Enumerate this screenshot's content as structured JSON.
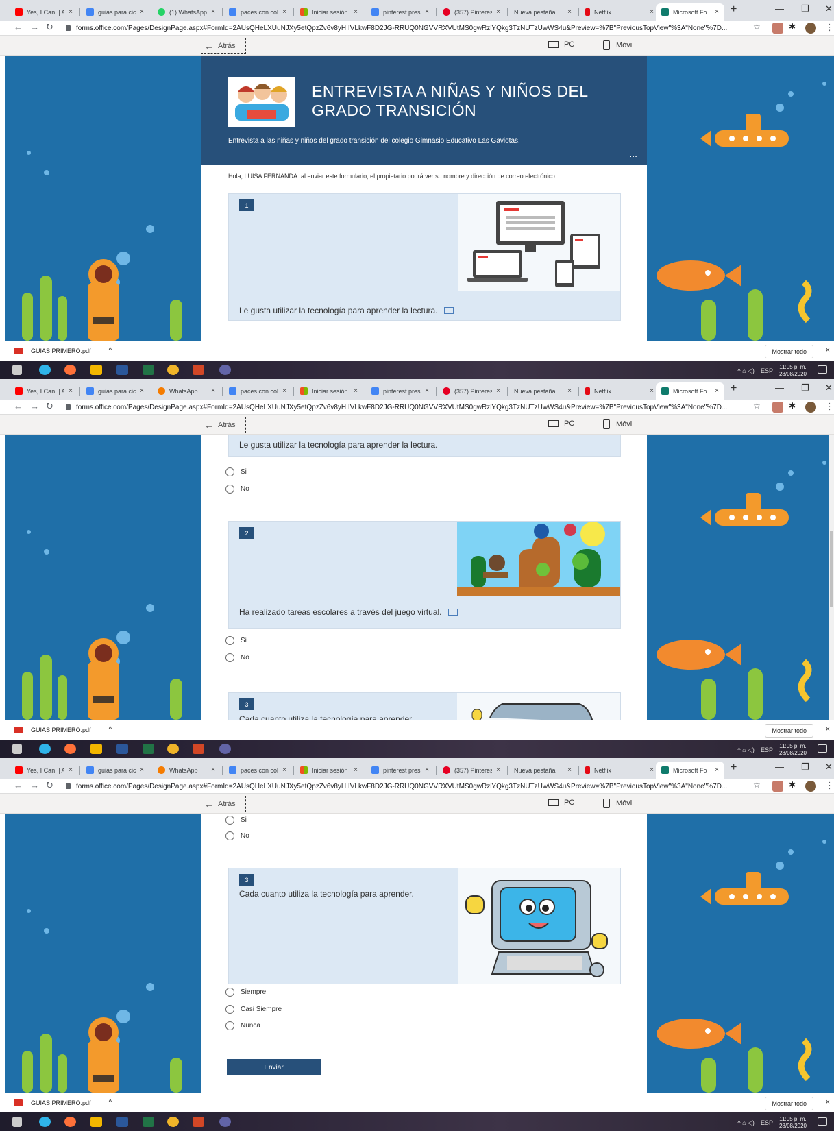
{
  "browser": {
    "tabs": [
      {
        "label": "Yes, I Can! | Al",
        "color": "#ff0000"
      },
      {
        "label": "guias para cic",
        "color": "#4285f4"
      },
      {
        "label": "(1) WhatsApp",
        "color": "#25d366"
      },
      {
        "label": "paces con col",
        "color": "#4285f4"
      },
      {
        "label": "Iniciar sesión",
        "color": "#f25022"
      },
      {
        "label": "pinterest pres",
        "color": "#4285f4"
      },
      {
        "label": "(357) Pinteres",
        "color": "#e60023"
      },
      {
        "label": "Nueva pestaña",
        "color": "#ffffff"
      },
      {
        "label": "Netflix",
        "color": "#e50914"
      },
      {
        "label": "Microsoft Fo",
        "color": "#0f7b6c"
      }
    ],
    "tabs_alt": {
      "whatsapp": "WhatsApp"
    },
    "url": "forms.office.com/Pages/DesignPage.aspx#FormId=2AUsQHeLXUuNJXy5etQpzZv6v8yHIIVLkwF8D2JG-RRUQ0NGVVRXVUtMS0gwRzlYQkg3TzNUTzUwWS4u&Preview=%7B\"PreviousTopView\"%3A\"None\"%7D...",
    "new_tab": "+",
    "close": "×"
  },
  "toolbar": {
    "back_label": "Atrás",
    "pc_label": "PC",
    "mobile_label": "Móvil"
  },
  "form": {
    "title": "ENTREVISTA A NIÑAS Y NIÑOS DEL GRADO TRANSICIÓN",
    "description": "Entrevista a las niñas y niños del grado transición del colegio Gimnasio Educativo Las Gaviotas.",
    "more": "...",
    "notice": "Hola, LUISA FERNANDA: al enviar este formulario, el propietario podrá ver su nombre y dirección de correo electrónico.",
    "questions": [
      {
        "number": "1",
        "text": "Le gusta utilizar la tecnología para aprender la lectura.",
        "options": [
          "Si",
          "No"
        ]
      },
      {
        "number": "2",
        "text": "Ha realizado tareas escolares a través del juego virtual.",
        "options": [
          "Si",
          "No"
        ]
      },
      {
        "number": "3",
        "text": "Cada cuanto utiliza la tecnología para aprender.",
        "text_partial": "Cada cuanto utiliza la tecnología para aprender",
        "options": [
          "Siempre",
          "Casi Siempre",
          "Nunca"
        ]
      }
    ],
    "submit_label": "Enviar"
  },
  "downloads": {
    "file": "GUIAS PRIMERO.pdf",
    "caret": "^",
    "show_all": "Mostrar todo",
    "close": "×"
  },
  "taskbar": {
    "lang": "ESP",
    "time": "11:05 p. m.",
    "date": "28/08/2020",
    "tray_icons": "^ ⌂ ◁)"
  },
  "colors": {
    "ocean": "#1f6fa8",
    "form_header": "#27507a",
    "question_bg": "#dce8f4",
    "submit": "#27507a",
    "submarine": "#f39a2c",
    "fish": "#f28a2e",
    "seaweed": "#8cc63f"
  }
}
